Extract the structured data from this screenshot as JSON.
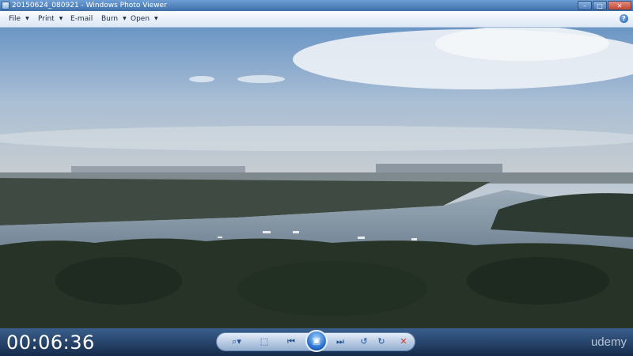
{
  "window": {
    "title": "20150624_080921 - Windows Photo Viewer",
    "icon": "photo-viewer-icon",
    "controls": {
      "minimize": "–",
      "maximize": "□",
      "close": "✕"
    }
  },
  "menu": {
    "items": [
      "File",
      "Print",
      "E-mail",
      "Burn",
      "Open"
    ],
    "dropdown_arrow": "▼",
    "help": "?"
  },
  "player": {
    "timestamp": "00:06:36",
    "brand": "udemy"
  },
  "toolbar": {
    "zoom": "⌕▾",
    "fit": "⬚",
    "previous": "⏮",
    "slideshow": "▣",
    "next": "⏭",
    "rotate_left": "↺",
    "rotate_right": "↻",
    "delete": "✕"
  },
  "colors": {
    "titlebar": "#3f6fa9",
    "menubar": "#dbe6f4",
    "bottombar": "#152b4a",
    "accent": "#1b66c6"
  }
}
